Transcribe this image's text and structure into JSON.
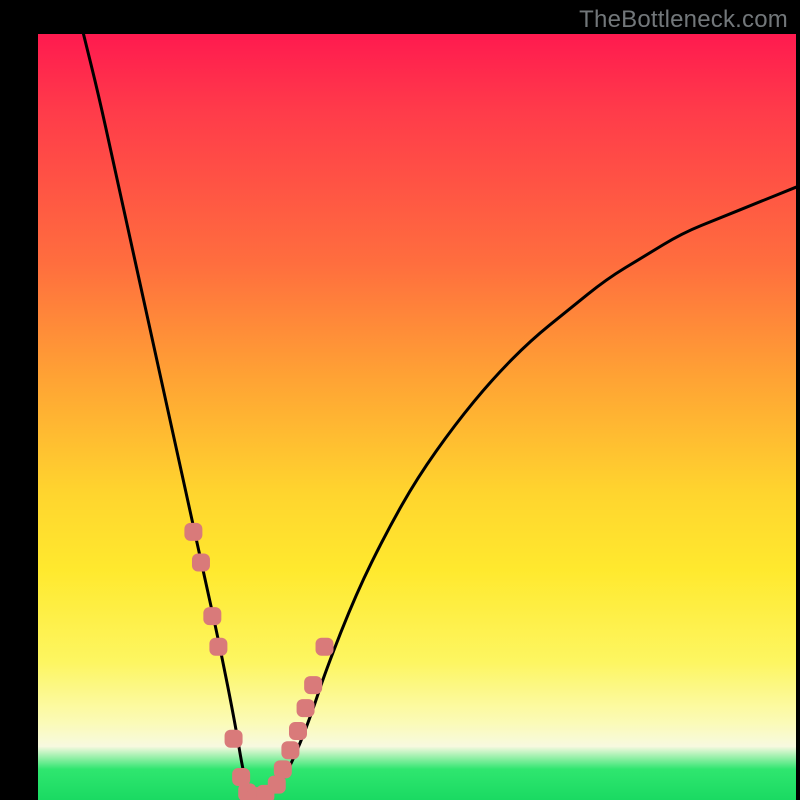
{
  "watermark": "TheBottleneck.com",
  "colors": {
    "background": "#000000",
    "gradient_top": "#ff1a4f",
    "gradient_mid": "#ffd52e",
    "gradient_bottom": "#1ada62",
    "curve": "#000000",
    "marker": "#d97a7a"
  },
  "chart_data": {
    "type": "line",
    "title": "",
    "xlabel": "",
    "ylabel": "",
    "xlim": [
      0,
      100
    ],
    "ylim": [
      0,
      100
    ],
    "series": [
      {
        "name": "bottleneck-curve",
        "x": [
          6,
          8,
          10,
          12,
          14,
          16,
          18,
          20,
          22,
          24,
          26,
          27,
          28,
          30,
          32,
          34,
          36,
          38,
          42,
          46,
          50,
          55,
          60,
          65,
          70,
          75,
          80,
          85,
          90,
          95,
          100
        ],
        "y": [
          100,
          92,
          83,
          74,
          65,
          56,
          47,
          38,
          29,
          20,
          10,
          4,
          0,
          0,
          2,
          6,
          11,
          17,
          27,
          35,
          42,
          49,
          55,
          60,
          64,
          68,
          71,
          74,
          76,
          78,
          80
        ]
      }
    ],
    "markers": {
      "name": "highlighted-region",
      "x": [
        20.5,
        21.5,
        23.0,
        23.8,
        25.8,
        26.8,
        27.6,
        28.8,
        30.0,
        31.5,
        32.3,
        33.3,
        34.3,
        35.3,
        36.3,
        37.8
      ],
      "y": [
        35,
        31,
        24,
        20,
        8,
        3,
        1,
        0.5,
        0.8,
        2,
        4,
        6.5,
        9,
        12,
        15,
        20
      ]
    }
  }
}
